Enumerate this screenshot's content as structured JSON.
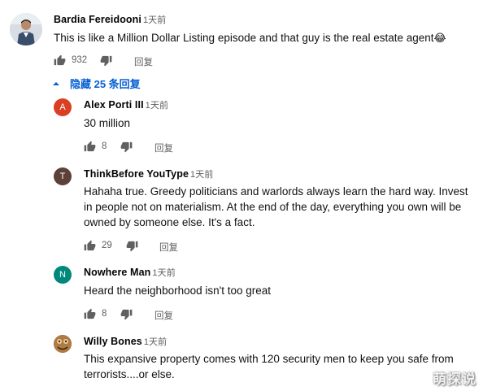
{
  "top_comment": {
    "author": "Bardia Fereidooni",
    "time": "1天前",
    "text": "This is like a Million Dollar Listing episode and that guy is the real estate agent",
    "emoji": "😂",
    "likes": "932",
    "reply_label": "回复"
  },
  "replies_toggle": {
    "label": "隐藏 25 条回复"
  },
  "replies": [
    {
      "avatar_letter": "A",
      "avatar_color": "#d93f22",
      "author": "Alex Porti III",
      "time": "1天前",
      "lines": [
        "30 million"
      ],
      "likes": "8",
      "reply_label": "回复"
    },
    {
      "avatar_letter": "T",
      "avatar_color": "#5d4037",
      "author": "ThinkBefore YouType",
      "time": "1天前",
      "lines": [
        "Hahaha true. Greedy politicians and warlords always learn the hard way. Invest",
        "in people not on materialism. At the end of the day, everything you own will be",
        "owned by someone else. It's a fact."
      ],
      "likes": "29",
      "reply_label": "回复"
    },
    {
      "avatar_letter": "N",
      "avatar_color": "#00897b",
      "author": "Nowhere Man",
      "time": "1天前",
      "lines": [
        "Heard the neighborhood isn't too great"
      ],
      "likes": "8",
      "reply_label": "回复"
    },
    {
      "avatar_letter": "",
      "avatar_color": "#8d5a2b",
      "author": "Willy Bones",
      "time": "1天前",
      "lines": [
        "This expansive property comes with 120 security men to keep you safe from",
        "terrorists....or else."
      ]
    }
  ],
  "watermark": "萌探说",
  "icons": {
    "like": "thumbs-up-icon",
    "dislike": "thumbs-down-icon",
    "collapse": "caret-up-icon"
  }
}
